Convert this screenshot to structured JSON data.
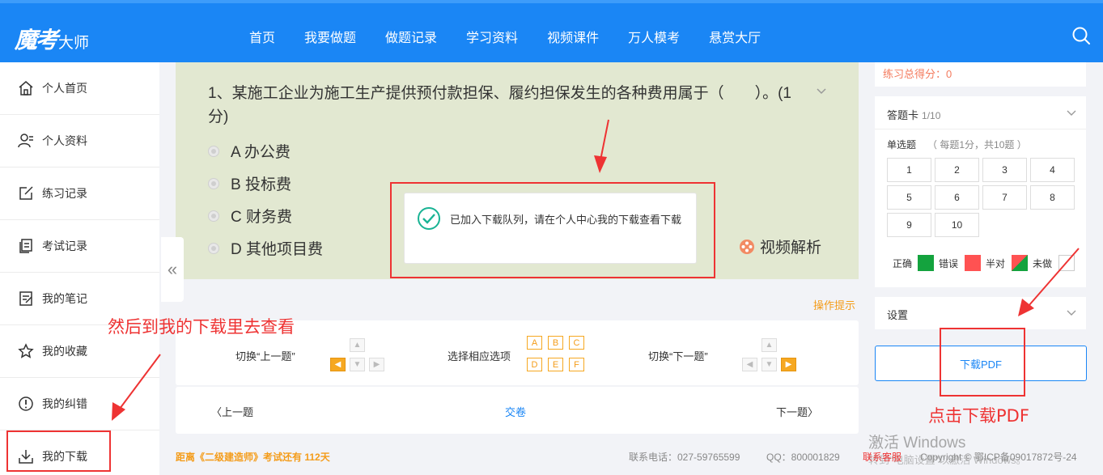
{
  "header": {
    "logo_script": "魔考",
    "logo_text": "大师",
    "nav": [
      "首页",
      "我要做题",
      "做题记录",
      "学习资料",
      "视频课件",
      "万人模考",
      "悬赏大厅"
    ]
  },
  "sidebar": {
    "items": [
      {
        "label": "个人首页",
        "icon": "home-icon"
      },
      {
        "label": "个人资料",
        "icon": "profile-icon"
      },
      {
        "label": "练习记录",
        "icon": "edit-icon"
      },
      {
        "label": "考试记录",
        "icon": "document-icon"
      },
      {
        "label": "我的笔记",
        "icon": "note-icon"
      },
      {
        "label": "我的收藏",
        "icon": "star-icon"
      },
      {
        "label": "我的纠错",
        "icon": "alert-icon"
      },
      {
        "label": "我的下载",
        "icon": "download-icon"
      }
    ]
  },
  "question": {
    "title": "1、某施工企业为施工生产提供预付款担保、履约担保发生的各种费用属于（　　）。(1分)",
    "options": [
      "A 办公费",
      "B 投标费",
      "C 财务费",
      "D 其他项目费"
    ],
    "video_analysis": "视频解析"
  },
  "toast": {
    "message": "已加入下载队列，请在个人中心我的下载查看下载"
  },
  "hints": {
    "op_hint": "操作提示",
    "prev_label": "切换“上一题”",
    "select_label": "选择相应选项",
    "next_label": "切换“下一题”",
    "letters": [
      "A",
      "B",
      "C",
      "D",
      "E",
      "F"
    ]
  },
  "pager": {
    "prev": "上一题",
    "submit": "交卷",
    "next": "下一题"
  },
  "footer": {
    "countdown": "距离《二级建造师》考试还有 112天",
    "phone": "联系电话：027-59765599",
    "qq": "QQ：800001829",
    "contact": "联系客服",
    "copyright": "Copyright © 鄂ICP备09017872号-24"
  },
  "watermark": {
    "line1": "激活 Windows",
    "line2": "转到\"电脑设置\"以激活 Windows。"
  },
  "right_panel": {
    "score": "练习总得分：0",
    "answer_card_title": "答题卡",
    "answer_card_count": "1/10",
    "question_type": "单选题",
    "question_type_meta": "（ 每题1分，共10题 ）",
    "numbers": [
      "1",
      "2",
      "3",
      "4",
      "5",
      "6",
      "7",
      "8",
      "9",
      "10"
    ],
    "legend": [
      "正确",
      "错误",
      "半对",
      "未做"
    ],
    "settings": "设置",
    "download_pdf": "下载PDF"
  },
  "colors": {
    "primary": "#1a86f5",
    "correct": "#14a33e",
    "wrong": "#ff5252",
    "accent": "#f49c1a",
    "annotation": "#e33333"
  },
  "annotations": {
    "left": "然后到我的下载里去查看",
    "right": "点击下载PDF"
  }
}
